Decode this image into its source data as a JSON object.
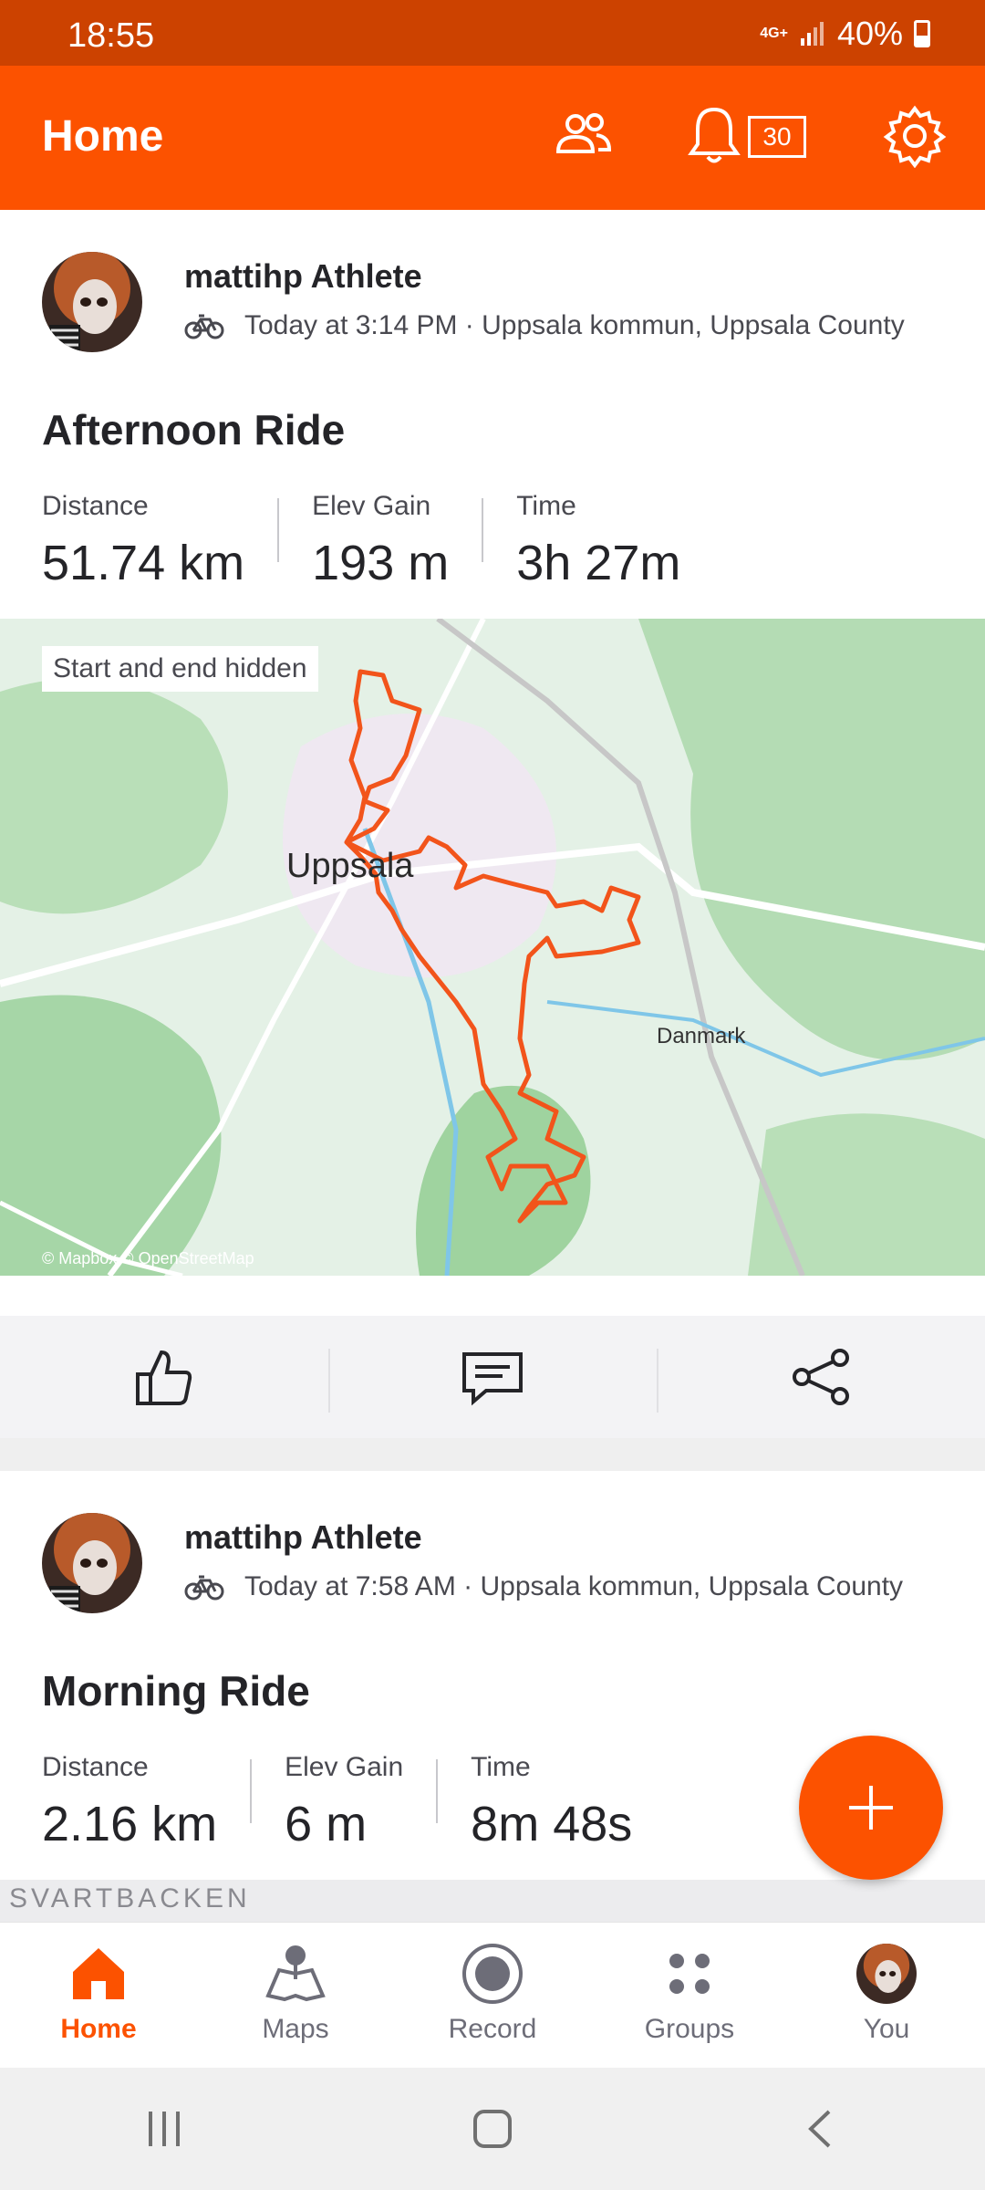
{
  "status_bar": {
    "time": "18:55",
    "network": "4G+",
    "battery": "40%"
  },
  "app_bar": {
    "title": "Home",
    "notification_count": "30"
  },
  "activities": [
    {
      "athlete": "mattihp Athlete",
      "meta": "Today at 3:14 PM · Uppsala kommun, Uppsala County",
      "title": "Afternoon Ride",
      "stats": [
        {
          "label": "Distance",
          "value": "51.74 km"
        },
        {
          "label": "Elev Gain",
          "value": "193 m"
        },
        {
          "label": "Time",
          "value": "3h 27m"
        }
      ],
      "map": {
        "badge": "Start and end hidden",
        "city": "Uppsala",
        "place": "Danmark",
        "attribution": "© Mapbox © OpenStreetMap"
      }
    },
    {
      "athlete": "mattihp Athlete",
      "meta": "Today at 7:58 AM · Uppsala kommun, Uppsala County",
      "title": "Morning Ride",
      "stats": [
        {
          "label": "Distance",
          "value": "2.16 km"
        },
        {
          "label": "Elev Gain",
          "value": "6 m"
        },
        {
          "label": "Time",
          "value": "8m 48s"
        }
      ],
      "map": {
        "label": "SVARTBACKEN"
      }
    }
  ],
  "bottom_nav": [
    {
      "label": "Home",
      "icon": "home-icon",
      "active": true
    },
    {
      "label": "Maps",
      "icon": "maps-icon",
      "active": false
    },
    {
      "label": "Record",
      "icon": "record-icon",
      "active": false
    },
    {
      "label": "Groups",
      "icon": "groups-icon",
      "active": false
    },
    {
      "label": "You",
      "icon": "avatar",
      "active": false
    }
  ],
  "colors": {
    "brand": "#fc5200",
    "status_bar": "#cc4200",
    "route": "#f2541b"
  }
}
